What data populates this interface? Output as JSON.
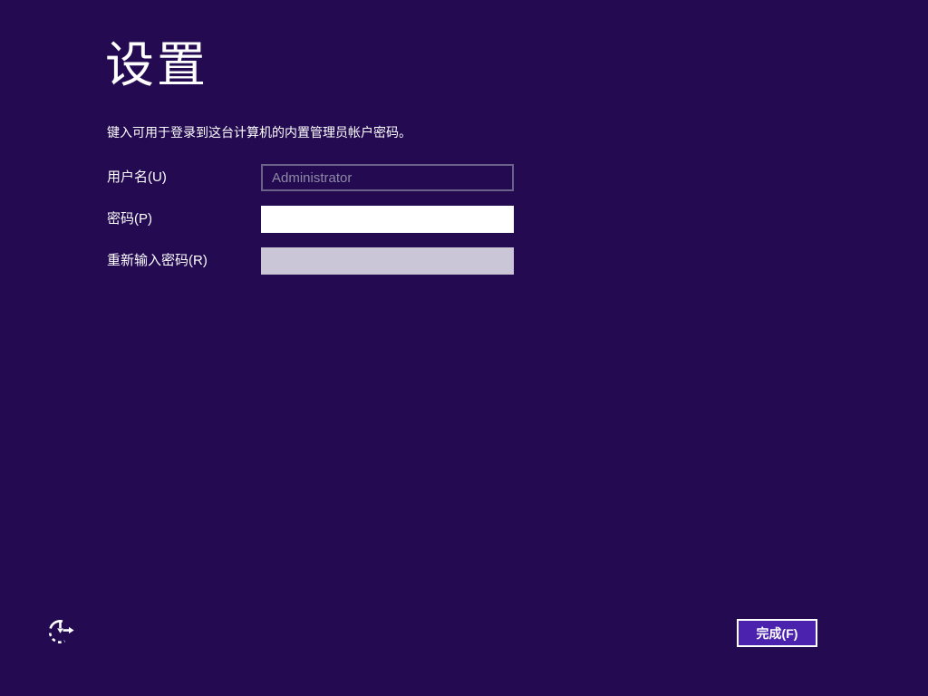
{
  "page": {
    "title": "设置",
    "subtitle": "键入可用于登录到这台计算机的内置管理员帐户密码。"
  },
  "form": {
    "username": {
      "label": "用户名(U)",
      "value": "Administrator",
      "state": "disabled"
    },
    "password": {
      "label": "密码(P)",
      "value": "",
      "state": "focused"
    },
    "confirm_password": {
      "label": "重新输入密码(R)",
      "value": "",
      "state": "enabled"
    }
  },
  "footer": {
    "finish_button_label": "完成(F)",
    "ease_of_access_icon": "ease-of-access-icon"
  },
  "colors": {
    "background": "#230a51",
    "button_fill": "#4a22ad",
    "button_border": "#ffffff",
    "disabled_field_border": "#6a6288",
    "disabled_field_text": "#8e89a6",
    "password_field_bg": "#ffffff",
    "confirm_field_bg": "#cac6d7",
    "text": "#ffffff"
  }
}
